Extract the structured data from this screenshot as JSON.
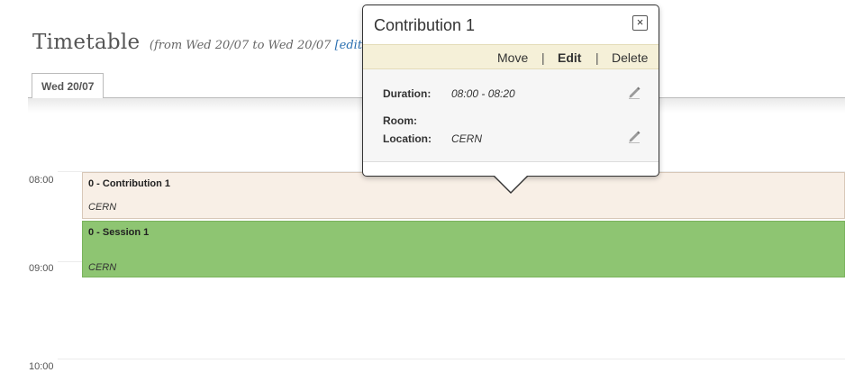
{
  "header": {
    "title": "Timetable",
    "range_prefix": "(from Wed 20/07 to Wed 20/07",
    "edit_link": "[edit]"
  },
  "tabs": [
    {
      "label": "Wed 20/07"
    }
  ],
  "hours": [
    "08:00",
    "09:00",
    "10:00"
  ],
  "blocks": {
    "contribution": {
      "title": "0 - Contribution 1",
      "location": "CERN",
      "color": "#f8efe6"
    },
    "session": {
      "title": "0 - Session 1",
      "location": "CERN",
      "color": "#8ec572"
    }
  },
  "balloon": {
    "title": "Contribution 1",
    "actions": {
      "move": "Move",
      "edit": "Edit",
      "delete": "Delete",
      "separator": "|"
    },
    "fields": {
      "duration_label": "Duration:",
      "duration_value": "08:00 - 08:20",
      "room_label": "Room:",
      "location_label": "Location:",
      "location_value": "CERN"
    },
    "icons": {
      "close": "close-icon",
      "edit": "pencil-icon"
    }
  }
}
